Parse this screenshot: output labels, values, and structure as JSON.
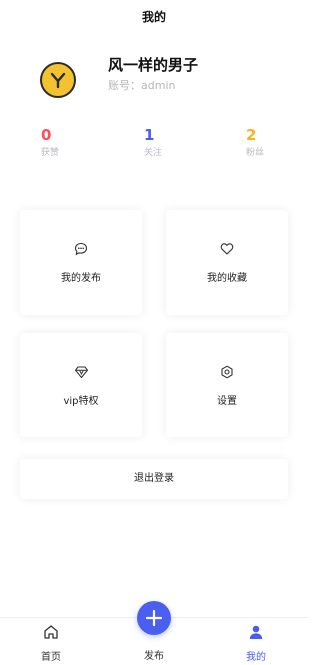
{
  "header": {
    "title": "我的"
  },
  "profile": {
    "nickname": "风一样的男子",
    "account": "账号：admin"
  },
  "stats": [
    {
      "value": "0",
      "label": "获赞",
      "color": "#ff4d5a"
    },
    {
      "value": "1",
      "label": "关注",
      "color": "#4b5cf0"
    },
    {
      "value": "2",
      "label": "粉丝",
      "color": "#f5b320"
    }
  ],
  "menu": {
    "my_posts": {
      "label": "我的发布",
      "icon": "chat-bubble-icon"
    },
    "my_favorites": {
      "label": "我的收藏",
      "icon": "heart-icon"
    },
    "vip": {
      "label": "vip特权",
      "icon": "diamond-icon"
    },
    "settings": {
      "label": "设置",
      "icon": "gear-icon"
    }
  },
  "logout": {
    "label": "退出登录"
  },
  "tabbar": {
    "home": {
      "label": "首页",
      "icon": "home-icon"
    },
    "publish": {
      "label": "发布",
      "icon": "plus-icon"
    },
    "mine": {
      "label": "我的",
      "icon": "user-icon",
      "active": true
    }
  },
  "colors": {
    "accent": "#4a5ef0",
    "avatar_bg": "#f2c230"
  }
}
